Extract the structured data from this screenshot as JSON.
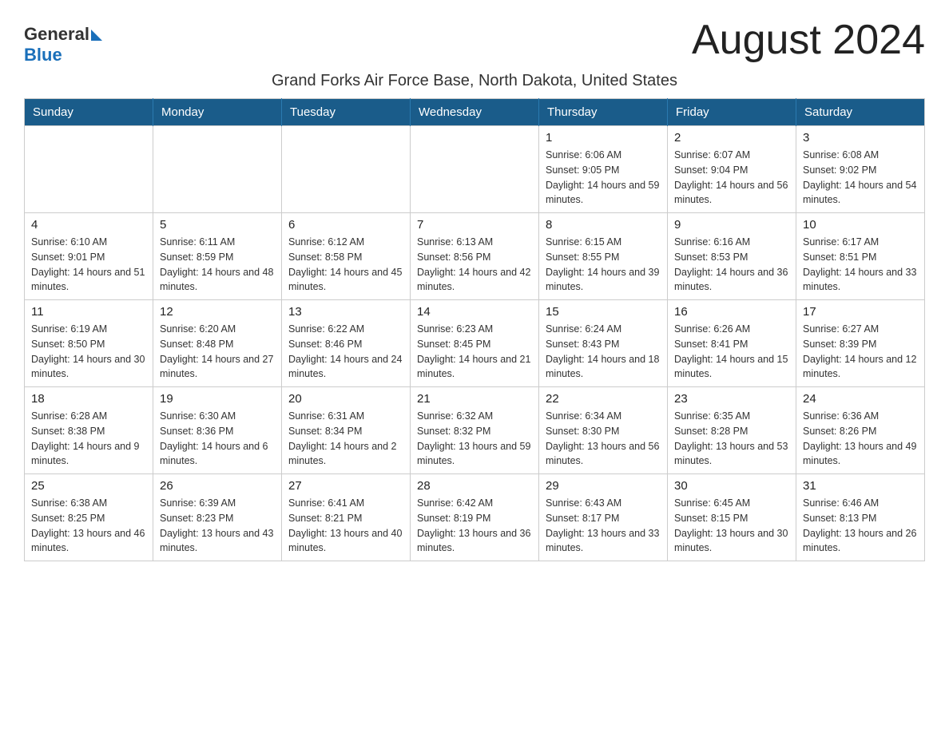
{
  "header": {
    "logo_general": "General",
    "logo_blue": "Blue",
    "month_title": "August 2024",
    "location": "Grand Forks Air Force Base, North Dakota, United States"
  },
  "weekdays": [
    "Sunday",
    "Monday",
    "Tuesday",
    "Wednesday",
    "Thursday",
    "Friday",
    "Saturday"
  ],
  "weeks": [
    [
      {
        "day": "",
        "info": ""
      },
      {
        "day": "",
        "info": ""
      },
      {
        "day": "",
        "info": ""
      },
      {
        "day": "",
        "info": ""
      },
      {
        "day": "1",
        "info": "Sunrise: 6:06 AM\nSunset: 9:05 PM\nDaylight: 14 hours and 59 minutes."
      },
      {
        "day": "2",
        "info": "Sunrise: 6:07 AM\nSunset: 9:04 PM\nDaylight: 14 hours and 56 minutes."
      },
      {
        "day": "3",
        "info": "Sunrise: 6:08 AM\nSunset: 9:02 PM\nDaylight: 14 hours and 54 minutes."
      }
    ],
    [
      {
        "day": "4",
        "info": "Sunrise: 6:10 AM\nSunset: 9:01 PM\nDaylight: 14 hours and 51 minutes."
      },
      {
        "day": "5",
        "info": "Sunrise: 6:11 AM\nSunset: 8:59 PM\nDaylight: 14 hours and 48 minutes."
      },
      {
        "day": "6",
        "info": "Sunrise: 6:12 AM\nSunset: 8:58 PM\nDaylight: 14 hours and 45 minutes."
      },
      {
        "day": "7",
        "info": "Sunrise: 6:13 AM\nSunset: 8:56 PM\nDaylight: 14 hours and 42 minutes."
      },
      {
        "day": "8",
        "info": "Sunrise: 6:15 AM\nSunset: 8:55 PM\nDaylight: 14 hours and 39 minutes."
      },
      {
        "day": "9",
        "info": "Sunrise: 6:16 AM\nSunset: 8:53 PM\nDaylight: 14 hours and 36 minutes."
      },
      {
        "day": "10",
        "info": "Sunrise: 6:17 AM\nSunset: 8:51 PM\nDaylight: 14 hours and 33 minutes."
      }
    ],
    [
      {
        "day": "11",
        "info": "Sunrise: 6:19 AM\nSunset: 8:50 PM\nDaylight: 14 hours and 30 minutes."
      },
      {
        "day": "12",
        "info": "Sunrise: 6:20 AM\nSunset: 8:48 PM\nDaylight: 14 hours and 27 minutes."
      },
      {
        "day": "13",
        "info": "Sunrise: 6:22 AM\nSunset: 8:46 PM\nDaylight: 14 hours and 24 minutes."
      },
      {
        "day": "14",
        "info": "Sunrise: 6:23 AM\nSunset: 8:45 PM\nDaylight: 14 hours and 21 minutes."
      },
      {
        "day": "15",
        "info": "Sunrise: 6:24 AM\nSunset: 8:43 PM\nDaylight: 14 hours and 18 minutes."
      },
      {
        "day": "16",
        "info": "Sunrise: 6:26 AM\nSunset: 8:41 PM\nDaylight: 14 hours and 15 minutes."
      },
      {
        "day": "17",
        "info": "Sunrise: 6:27 AM\nSunset: 8:39 PM\nDaylight: 14 hours and 12 minutes."
      }
    ],
    [
      {
        "day": "18",
        "info": "Sunrise: 6:28 AM\nSunset: 8:38 PM\nDaylight: 14 hours and 9 minutes."
      },
      {
        "day": "19",
        "info": "Sunrise: 6:30 AM\nSunset: 8:36 PM\nDaylight: 14 hours and 6 minutes."
      },
      {
        "day": "20",
        "info": "Sunrise: 6:31 AM\nSunset: 8:34 PM\nDaylight: 14 hours and 2 minutes."
      },
      {
        "day": "21",
        "info": "Sunrise: 6:32 AM\nSunset: 8:32 PM\nDaylight: 13 hours and 59 minutes."
      },
      {
        "day": "22",
        "info": "Sunrise: 6:34 AM\nSunset: 8:30 PM\nDaylight: 13 hours and 56 minutes."
      },
      {
        "day": "23",
        "info": "Sunrise: 6:35 AM\nSunset: 8:28 PM\nDaylight: 13 hours and 53 minutes."
      },
      {
        "day": "24",
        "info": "Sunrise: 6:36 AM\nSunset: 8:26 PM\nDaylight: 13 hours and 49 minutes."
      }
    ],
    [
      {
        "day": "25",
        "info": "Sunrise: 6:38 AM\nSunset: 8:25 PM\nDaylight: 13 hours and 46 minutes."
      },
      {
        "day": "26",
        "info": "Sunrise: 6:39 AM\nSunset: 8:23 PM\nDaylight: 13 hours and 43 minutes."
      },
      {
        "day": "27",
        "info": "Sunrise: 6:41 AM\nSunset: 8:21 PM\nDaylight: 13 hours and 40 minutes."
      },
      {
        "day": "28",
        "info": "Sunrise: 6:42 AM\nSunset: 8:19 PM\nDaylight: 13 hours and 36 minutes."
      },
      {
        "day": "29",
        "info": "Sunrise: 6:43 AM\nSunset: 8:17 PM\nDaylight: 13 hours and 33 minutes."
      },
      {
        "day": "30",
        "info": "Sunrise: 6:45 AM\nSunset: 8:15 PM\nDaylight: 13 hours and 30 minutes."
      },
      {
        "day": "31",
        "info": "Sunrise: 6:46 AM\nSunset: 8:13 PM\nDaylight: 13 hours and 26 minutes."
      }
    ]
  ]
}
